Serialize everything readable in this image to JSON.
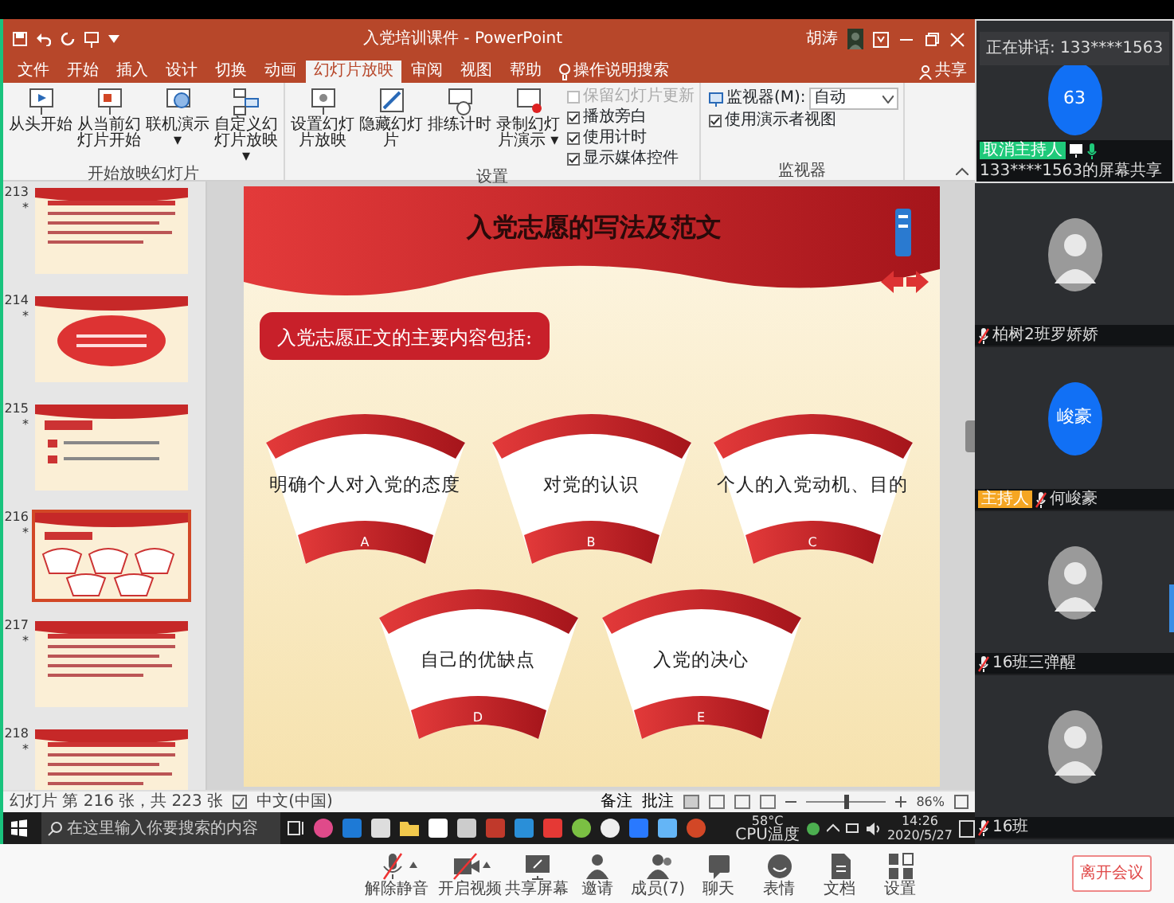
{
  "window": {
    "title": "入党培训课件 - PowerPoint",
    "user": "胡涛",
    "share": "共享"
  },
  "tabs": [
    {
      "label": "文件",
      "selected": false
    },
    {
      "label": "开始",
      "selected": false
    },
    {
      "label": "插入",
      "selected": false
    },
    {
      "label": "设计",
      "selected": false
    },
    {
      "label": "切换",
      "selected": false
    },
    {
      "label": "动画",
      "selected": false
    },
    {
      "label": "幻灯片放映",
      "selected": true
    },
    {
      "label": "审阅",
      "selected": false
    },
    {
      "label": "视图",
      "selected": false
    },
    {
      "label": "帮助",
      "selected": false
    }
  ],
  "tell_me": "操作说明搜索",
  "ribbon": [
    {
      "label": "开始放映幻灯片",
      "buttons": [
        {
          "label": "从头开始",
          "kind": "play"
        },
        {
          "label": "从当前幻灯片开始",
          "kind": "play-current"
        },
        {
          "label": "联机演示 ▾",
          "kind": "online"
        },
        {
          "label": "自定义幻灯片放映 ▾",
          "kind": "custom"
        }
      ]
    },
    {
      "label": "设置",
      "buttons": [
        {
          "label": "设置幻灯片放映",
          "kind": "setup"
        },
        {
          "label": "隐藏幻灯片",
          "kind": "hide"
        },
        {
          "label": "排练计时",
          "kind": "timer"
        },
        {
          "label": "录制幻灯片演示 ▾",
          "kind": "record"
        }
      ],
      "checks": [
        {
          "label": "保留幻灯片更新",
          "checked": false,
          "disabled": true
        },
        {
          "label": "播放旁白",
          "checked": true,
          "disabled": false
        },
        {
          "label": "使用计时",
          "checked": true,
          "disabled": false
        },
        {
          "label": "显示媒体控件",
          "checked": true,
          "disabled": false
        }
      ]
    },
    {
      "label": "监视器",
      "checks": [
        {
          "label": "使用演示者视图",
          "checked": true,
          "disabled": false
        }
      ],
      "monitor": {
        "label": "监视器(M):",
        "value": "自动"
      }
    }
  ],
  "thumbnails": [
    {
      "number": "213",
      "mark": "*",
      "selected": false,
      "kind": "text"
    },
    {
      "number": "214",
      "mark": "*",
      "selected": false,
      "kind": "oval"
    },
    {
      "number": "215",
      "mark": "*",
      "selected": false,
      "kind": "list"
    },
    {
      "number": "216",
      "mark": "*",
      "selected": true,
      "kind": "fans"
    },
    {
      "number": "217",
      "mark": "*",
      "selected": false,
      "kind": "text"
    },
    {
      "number": "218",
      "mark": "*",
      "selected": false,
      "kind": "text"
    }
  ],
  "slide": {
    "title": "入党志愿的写法及范文",
    "subtitle": "入党志愿正文的主要内容包括:",
    "items": [
      {
        "text": "明确个人对入党的态度",
        "letter": "A"
      },
      {
        "text": "对党的认识",
        "letter": "B"
      },
      {
        "text": "个人的入党动机、目的",
        "letter": "C"
      },
      {
        "text": "自己的优缺点",
        "letter": "D"
      },
      {
        "text": "入党的决心",
        "letter": "E"
      }
    ]
  },
  "status_bar": {
    "slide_counter": "幻灯片 第 216 张，共 223 张",
    "language": "中文(中国)",
    "notes": "备注",
    "comments": "批注",
    "zoom": "86%",
    "zoom_slider": {
      "level": 0.5
    }
  },
  "taskbar": {
    "search_placeholder": "在这里输入你要搜索的内容",
    "temperature": "58°C",
    "temperature_label": "CPU温度",
    "time": "14:26",
    "date": "2020/5/27"
  },
  "meeting": {
    "speaking": "正在讲话: 133****1563",
    "participants": [
      {
        "kind": "initial",
        "avatar_text": "63",
        "badge": {
          "text": "取消主持人",
          "color": "#1fc97a"
        },
        "screen_share": true,
        "muted": false,
        "name": "133****1563的屏幕共享",
        "active": true
      },
      {
        "kind": "photo",
        "screen_share": false,
        "muted": true,
        "name": "柏树2班罗娇娇",
        "active": false
      },
      {
        "kind": "initial",
        "avatar_text": "峻豪",
        "badge": {
          "text": "主持人",
          "color": "#f5a623"
        },
        "screen_share": false,
        "muted": true,
        "name": "何峻豪",
        "active": false
      },
      {
        "kind": "photo",
        "screen_share": false,
        "muted": true,
        "name": "16班三弹醒",
        "active": false
      },
      {
        "kind": "photo",
        "screen_share": false,
        "muted": true,
        "name": "16班",
        "active": false
      }
    ],
    "toolbar": [
      {
        "label": "解除静音",
        "kind": "mic-off",
        "menu": true
      },
      {
        "label": "开启视频",
        "kind": "camera-off",
        "menu": true
      },
      {
        "label": "共享屏幕",
        "kind": "share",
        "menu": false
      },
      {
        "label": "邀请",
        "kind": "invite",
        "menu": false
      },
      {
        "label": "成员(7)",
        "kind": "members",
        "menu": false
      },
      {
        "label": "聊天",
        "kind": "chat",
        "menu": false
      },
      {
        "label": "表情",
        "kind": "emoji",
        "menu": false
      },
      {
        "label": "文档",
        "kind": "doc",
        "menu": false
      },
      {
        "label": "设置",
        "kind": "settings",
        "menu": false
      }
    ],
    "leave": "离开会议"
  }
}
